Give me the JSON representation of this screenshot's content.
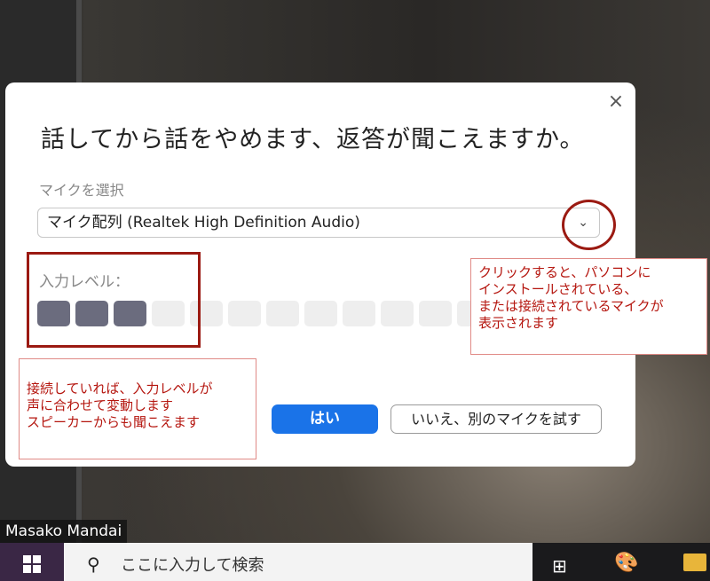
{
  "video": {
    "participant_name": "Masako Mandai"
  },
  "dialog": {
    "title": "話してから話をやめます、返答が聞こえますか。",
    "close_icon": "×",
    "mic_label": "マイクを選択",
    "mic_selected": "マイク配列 (Realtek High Definition Audio)",
    "dropdown_icon": "⌄",
    "level_label": "入力レベル：",
    "level_total_segments": 14,
    "level_active_segments": 3,
    "yes_button": "はい",
    "no_button": "いいえ、別のマイクを試す"
  },
  "annotations": {
    "callout_right": "クリックすると、パソコンに\nインストールされている、\nまたは接続されているマイクが\n表示されます",
    "callout_left": "接続していれば、入力レベルが\n声に合わせて変動します\nスピーカーからも聞こえます",
    "color": "#b5160f"
  },
  "taskbar": {
    "search_placeholder": "ここに入力して検索",
    "search_icon": "⚲"
  }
}
